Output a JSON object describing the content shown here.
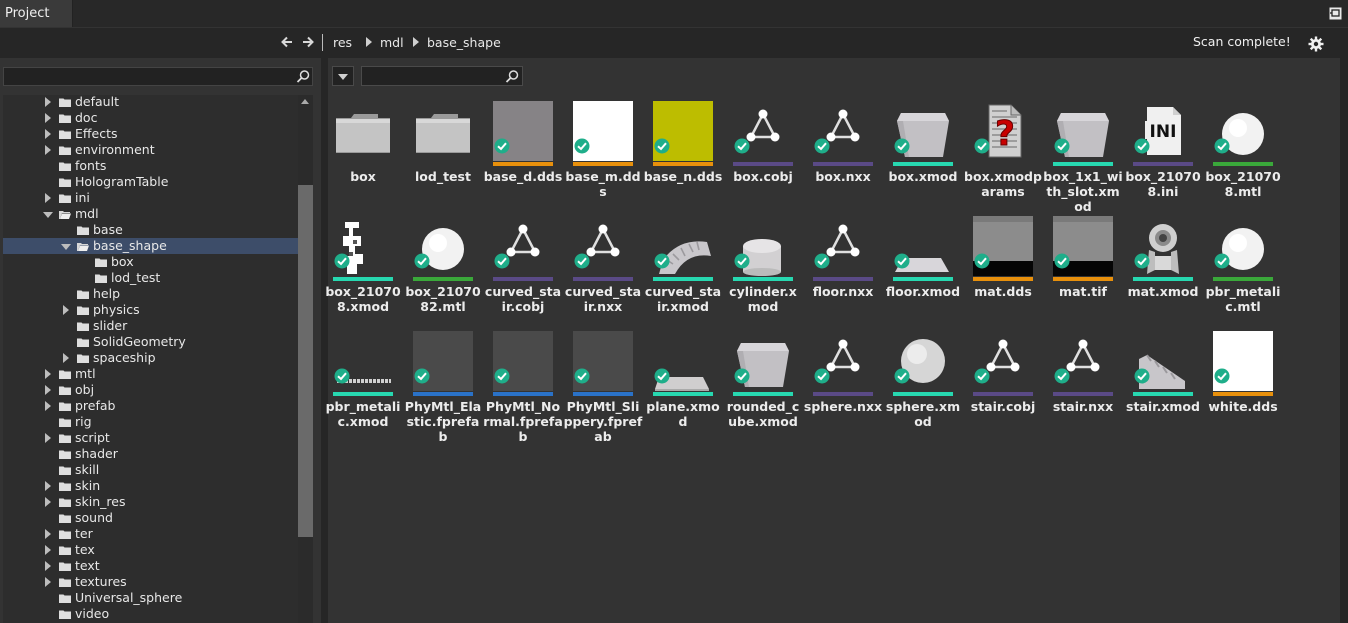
{
  "tab": {
    "label": "Project"
  },
  "breadcrumb": [
    "res",
    "mdl",
    "base_shape"
  ],
  "status": "Scan complete!",
  "left_search": {
    "value": "",
    "placeholder": ""
  },
  "right_search": {
    "value": "",
    "placeholder": ""
  },
  "tree": [
    {
      "label": "default",
      "level": 0,
      "arrow": "collapsed"
    },
    {
      "label": "doc",
      "level": 0,
      "arrow": "collapsed"
    },
    {
      "label": "Effects",
      "level": 0,
      "arrow": "collapsed"
    },
    {
      "label": "environment",
      "level": 0,
      "arrow": "collapsed"
    },
    {
      "label": "fonts",
      "level": 0,
      "arrow": "none"
    },
    {
      "label": "HologramTable",
      "level": 0,
      "arrow": "none"
    },
    {
      "label": "ini",
      "level": 0,
      "arrow": "collapsed"
    },
    {
      "label": "mdl",
      "level": 0,
      "arrow": "expanded"
    },
    {
      "label": "base",
      "level": 1,
      "arrow": "none"
    },
    {
      "label": "base_shape",
      "level": 1,
      "arrow": "expanded",
      "selected": true
    },
    {
      "label": "box",
      "level": 2,
      "arrow": "none"
    },
    {
      "label": "lod_test",
      "level": 2,
      "arrow": "none"
    },
    {
      "label": "help",
      "level": 1,
      "arrow": "none"
    },
    {
      "label": "physics",
      "level": 1,
      "arrow": "collapsed"
    },
    {
      "label": "slider",
      "level": 1,
      "arrow": "none"
    },
    {
      "label": "SolidGeometry",
      "level": 1,
      "arrow": "none"
    },
    {
      "label": "spaceship",
      "level": 1,
      "arrow": "collapsed"
    },
    {
      "label": "mtl",
      "level": 0,
      "arrow": "collapsed"
    },
    {
      "label": "obj",
      "level": 0,
      "arrow": "collapsed"
    },
    {
      "label": "prefab",
      "level": 0,
      "arrow": "collapsed"
    },
    {
      "label": "rig",
      "level": 0,
      "arrow": "none"
    },
    {
      "label": "script",
      "level": 0,
      "arrow": "collapsed"
    },
    {
      "label": "shader",
      "level": 0,
      "arrow": "none"
    },
    {
      "label": "skill",
      "level": 0,
      "arrow": "none"
    },
    {
      "label": "skin",
      "level": 0,
      "arrow": "collapsed"
    },
    {
      "label": "skin_res",
      "level": 0,
      "arrow": "collapsed"
    },
    {
      "label": "sound",
      "level": 0,
      "arrow": "none"
    },
    {
      "label": "ter",
      "level": 0,
      "arrow": "collapsed"
    },
    {
      "label": "tex",
      "level": 0,
      "arrow": "collapsed"
    },
    {
      "label": "text",
      "level": 0,
      "arrow": "collapsed"
    },
    {
      "label": "textures",
      "level": 0,
      "arrow": "collapsed"
    },
    {
      "label": "Universal_sphere",
      "level": 0,
      "arrow": "none"
    },
    {
      "label": "video",
      "level": 0,
      "arrow": "none"
    }
  ],
  "files": [
    {
      "name": "box",
      "thumb": "folder",
      "bar": null,
      "check": false
    },
    {
      "name": "lod_test",
      "thumb": "folder",
      "bar": null,
      "check": false
    },
    {
      "name": "base_d.dds",
      "thumb": "texture-gray",
      "bar": "#e8900c",
      "check": true
    },
    {
      "name": "base_m.dds",
      "thumb": "texture-white",
      "bar": "#e8900c",
      "check": true
    },
    {
      "name": "base_n.dds",
      "thumb": "texture-yellow",
      "bar": "#e8900c",
      "check": true
    },
    {
      "name": "box.cobj",
      "thumb": "mesh-graph",
      "bar": "#5a4a86",
      "check": true
    },
    {
      "name": "box.nxx",
      "thumb": "mesh-graph",
      "bar": "#5a4a86",
      "check": true
    },
    {
      "name": "box.xmod",
      "thumb": "model-box",
      "bar": "#27d8b0",
      "check": true
    },
    {
      "name": "box.xmodparams",
      "thumb": "unknown-doc",
      "bar": null,
      "check": true
    },
    {
      "name": "box_1x1_with_slot.xmod",
      "thumb": "model-box",
      "bar": "#27d8b0",
      "check": true
    },
    {
      "name": "box_210708.ini",
      "thumb": "ini-doc",
      "bar": "#5a4a86",
      "check": true
    },
    {
      "name": "box_210708.mtl",
      "thumb": "material-sphere",
      "bar": "#3aa83a",
      "check": true
    },
    {
      "name": "box_210708.xmod",
      "thumb": "model-jagged",
      "bar": "#27d8b0",
      "check": true
    },
    {
      "name": "box_2107082.mtl",
      "thumb": "material-sphere",
      "bar": "#3aa83a",
      "check": true
    },
    {
      "name": "curved_stair.cobj",
      "thumb": "mesh-graph",
      "bar": "#5a4a86",
      "check": true
    },
    {
      "name": "curved_stair.nxx",
      "thumb": "mesh-graph",
      "bar": "#5a4a86",
      "check": true
    },
    {
      "name": "curved_stair.xmod",
      "thumb": "model-curved",
      "bar": "#27d8b0",
      "check": true
    },
    {
      "name": "cylinder.xmod",
      "thumb": "model-cylinder",
      "bar": "#27d8b0",
      "check": true
    },
    {
      "name": "floor.nxx",
      "thumb": "mesh-graph",
      "bar": "#5a4a86",
      "check": true
    },
    {
      "name": "floor.xmod",
      "thumb": "model-floor",
      "bar": "#27d8b0",
      "check": true
    },
    {
      "name": "mat.dds",
      "thumb": "texture-mat",
      "bar": "#e8900c",
      "check": true
    },
    {
      "name": "mat.tif",
      "thumb": "texture-mat",
      "bar": "#e8900c",
      "check": true
    },
    {
      "name": "mat.xmod",
      "thumb": "model-robot",
      "bar": "#27d8b0",
      "check": true
    },
    {
      "name": "pbr_metalic.mtl",
      "thumb": "material-sphere",
      "bar": "#3aa83a",
      "check": true
    },
    {
      "name": "pbr_metalic.xmod",
      "thumb": "model-line",
      "bar": "#27d8b0",
      "check": true
    },
    {
      "name": "PhyMtl_Elastic.fprefab",
      "thumb": "prefab-dark",
      "bar": "#2a72c8",
      "check": true
    },
    {
      "name": "PhyMtl_Normal.fprefab",
      "thumb": "prefab-dark",
      "bar": "#2a72c8",
      "check": true
    },
    {
      "name": "PhyMtl_Slippery.fprefab",
      "thumb": "prefab-dark",
      "bar": "#2a72c8",
      "check": true
    },
    {
      "name": "plane.xmod",
      "thumb": "model-plane",
      "bar": "#27d8b0",
      "check": true
    },
    {
      "name": "rounded_cube.xmod",
      "thumb": "model-box",
      "bar": "#27d8b0",
      "check": true
    },
    {
      "name": "sphere.nxx",
      "thumb": "mesh-graph",
      "bar": "#5a4a86",
      "check": true
    },
    {
      "name": "sphere.xmod",
      "thumb": "model-sphere",
      "bar": "#27d8b0",
      "check": true
    },
    {
      "name": "stair.cobj",
      "thumb": "mesh-graph",
      "bar": "#5a4a86",
      "check": true
    },
    {
      "name": "stair.nxx",
      "thumb": "mesh-graph",
      "bar": "#5a4a86",
      "check": true
    },
    {
      "name": "stair.xmod",
      "thumb": "model-stair",
      "bar": "#27d8b0",
      "check": true
    },
    {
      "name": "white.dds",
      "thumb": "texture-white",
      "bar": "#e8900c",
      "check": true
    }
  ]
}
